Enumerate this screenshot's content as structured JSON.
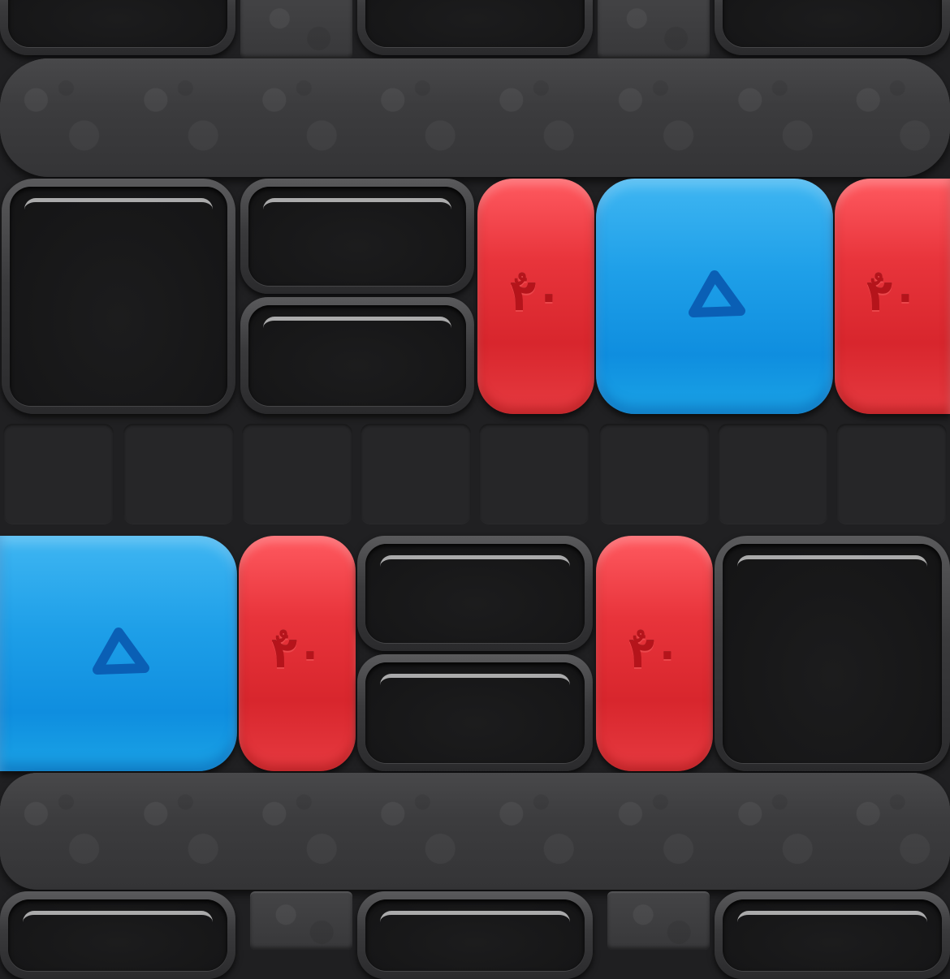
{
  "game": {
    "name": "jelly-block-puzzle",
    "colors": {
      "background": "#202022",
      "stone": "#3a3a3c",
      "socket_inner": "#161617",
      "red_piece": "#e3313a",
      "blue_piece": "#1e9fe8",
      "red_glyph": "#b5141b",
      "blue_glyph": "#0a5fb5"
    },
    "pieces": [
      {
        "type": "red",
        "orientation": "vertical",
        "icon": "red-glyph-icon"
      },
      {
        "type": "blue",
        "orientation": "square",
        "icon": "triangle-icon"
      },
      {
        "type": "red",
        "orientation": "vertical",
        "icon": "red-glyph-icon"
      },
      {
        "type": "blue",
        "orientation": "square",
        "icon": "triangle-icon"
      },
      {
        "type": "red",
        "orientation": "vertical",
        "icon": "red-glyph-icon"
      },
      {
        "type": "red",
        "orientation": "vertical",
        "icon": "red-glyph-icon"
      }
    ],
    "red_glyph_text": "ٌ۲۰"
  }
}
